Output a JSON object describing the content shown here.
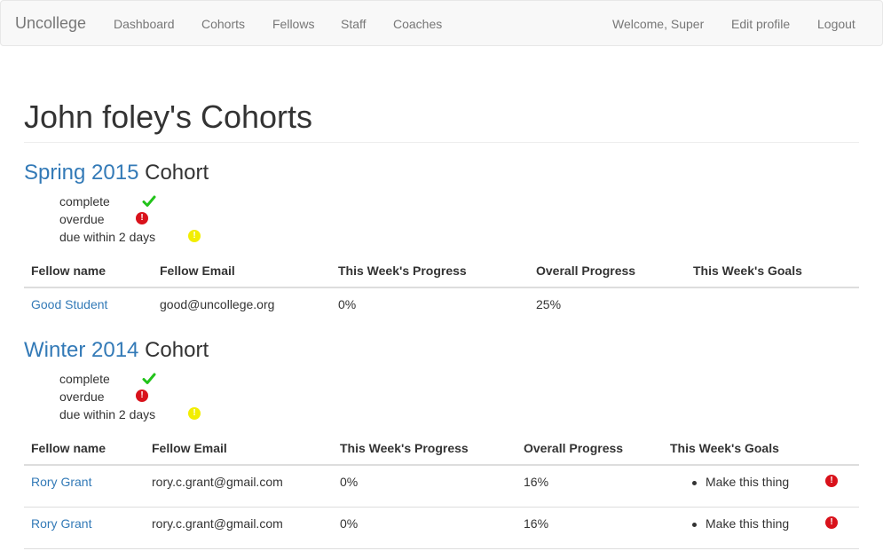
{
  "nav": {
    "brand": "Uncollege",
    "links": [
      "Dashboard",
      "Cohorts",
      "Fellows",
      "Staff",
      "Coaches"
    ],
    "welcome": "Welcome, Super",
    "edit_profile": "Edit profile",
    "logout": "Logout"
  },
  "page": {
    "title": "John foley's Cohorts"
  },
  "legend": {
    "complete": "complete",
    "overdue": "overdue",
    "due_soon": "due within 2 days",
    "overdue_glyph": "!",
    "due_soon_glyph": "!"
  },
  "colors": {
    "link": "#337ab7",
    "complete": "#22c31a",
    "overdue": "#d9121b",
    "due_soon": "#f2ee00"
  },
  "cohorts": [
    {
      "name": "Spring 2015",
      "suffix": "Cohort",
      "headers": [
        "Fellow name",
        "Fellow Email",
        "This Week's Progress",
        "Overall Progress",
        "This Week's Goals"
      ],
      "rows": [
        {
          "name": "Good Student",
          "email": "good@uncollege.org",
          "week": "0%",
          "overall": "25%",
          "goal": ""
        }
      ]
    },
    {
      "name": "Winter 2014",
      "suffix": "Cohort",
      "headers": [
        "Fellow name",
        "Fellow Email",
        "This Week's Progress",
        "Overall Progress",
        "This Week's Goals"
      ],
      "rows": [
        {
          "name": "Rory Grant",
          "email": "rory.c.grant@gmail.com",
          "week": "0%",
          "overall": "16%",
          "goal": "Make this thing",
          "goal_status": "overdue"
        },
        {
          "name": "Rory Grant",
          "email": "rory.c.grant@gmail.com",
          "week": "0%",
          "overall": "16%",
          "goal": "Make this thing",
          "goal_status": "overdue"
        }
      ]
    }
  ]
}
